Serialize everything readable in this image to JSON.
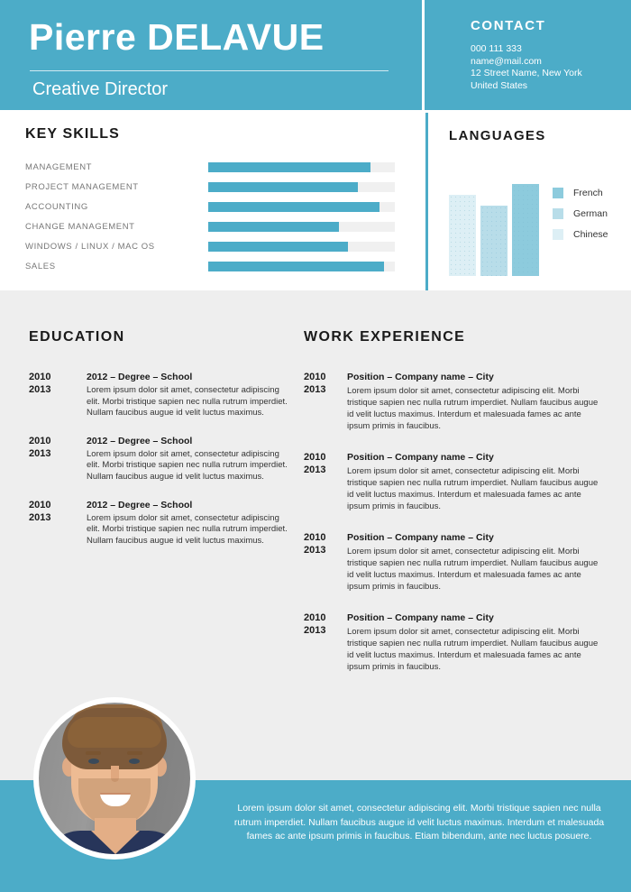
{
  "header": {
    "first_name": "Pierre",
    "last_name": "DELAVUE",
    "role": "Creative Director"
  },
  "contact": {
    "title": "CONTACT",
    "phone": "000 111 333",
    "email": "name@mail.com",
    "address": "12 Street Name, New York",
    "country": "United States"
  },
  "skills": {
    "title": "KEY SKILLS",
    "items": [
      {
        "label": "MANAGEMENT",
        "value": 87
      },
      {
        "label": "PROJECT  MANAGEMENT",
        "value": 80
      },
      {
        "label": "ACCOUNTING",
        "value": 92
      },
      {
        "label": "CHANGE  MANAGEMENT",
        "value": 70
      },
      {
        "label": "WINDOWS / LINUX  / MAC OS",
        "value": 75
      },
      {
        "label": "SALES",
        "value": 94
      }
    ]
  },
  "languages": {
    "title": "LANGUAGES",
    "legend": [
      {
        "label": "French",
        "color": "#8dcbdd"
      },
      {
        "label": "German",
        "color": "#b8dde9"
      },
      {
        "label": "Chinese",
        "color": "#ddeff5"
      }
    ]
  },
  "chart_data": {
    "type": "bar",
    "title": "LANGUAGES",
    "categories": [
      "Chinese",
      "German",
      "French"
    ],
    "values": [
      75,
      65,
      85
    ],
    "colors": [
      "#ddeff5",
      "#b8dde9",
      "#8dcbdd"
    ],
    "legend": [
      "French",
      "German",
      "Chinese"
    ],
    "legend_position": "right",
    "xlabel": "",
    "ylabel": "",
    "ylim": [
      0,
      100
    ],
    "grid": false
  },
  "education": {
    "title": "EDUCATION",
    "entries": [
      {
        "year_start": "2010",
        "year_end": "2013",
        "title": "2012 – Degree – School",
        "description": "Lorem  ipsum dolor sit amet, consectetur adipiscing elit. Morbi tristique sapien nec nulla rutrum imperdiet. Nullam faucibus augue id velit luctus maximus."
      },
      {
        "year_start": "2010",
        "year_end": "2013",
        "title": "2012 – Degree – School",
        "description": "Lorem  ipsum dolor sit amet, consectetur adipiscing elit. Morbi tristique sapien nec nulla rutrum imperdiet. Nullam faucibus augue id velit luctus maximus."
      },
      {
        "year_start": "2010",
        "year_end": "2013",
        "title": "2012 – Degree – School",
        "description": "Lorem  ipsum dolor sit amet, consectetur adipiscing elit. Morbi tristique sapien nec nulla rutrum imperdiet. Nullam faucibus augue id velit luctus maximus."
      }
    ]
  },
  "work": {
    "title": "WORK EXPERIENCE",
    "entries": [
      {
        "year_start": "2010",
        "year_end": "2013",
        "title": "Position – Company name – City",
        "description": "Lorem  ipsum dolor sit amet, consectetur  adipiscing elit. Morbi tristique sapien nec nulla rutrum imperdiet. Nullam faucibus augue id velit luctus maximus. Interdum et malesuada fames ac ante ipsum primis in faucibus."
      },
      {
        "year_start": "2010",
        "year_end": "2013",
        "title": "Position – Company name – City",
        "description": "Lorem  ipsum dolor sit amet, consectetur  adipiscing elit. Morbi tristique sapien nec nulla rutrum imperdiet. Nullam faucibus augue id velit luctus maximus. Interdum et malesuada fames ac ante ipsum primis in faucibus."
      },
      {
        "year_start": "2010",
        "year_end": "2013",
        "title": "Position – Company name – City",
        "description": "Lorem  ipsum dolor sit amet, consectetur  adipiscing elit. Morbi tristique sapien nec nulla rutrum imperdiet. Nullam faucibus augue id velit luctus maximus. Interdum et malesuada fames ac ante ipsum primis in faucibus."
      },
      {
        "year_start": "2010",
        "year_end": "2013",
        "title": "Position – Company name – City",
        "description": "Lorem  ipsum dolor sit amet, consectetur  adipiscing elit. Morbi tristique sapien nec nulla rutrum imperdiet. Nullam faucibus augue id velit luctus maximus. Interdum et malesuada fames ac ante ipsum primis in faucibus."
      }
    ]
  },
  "footer": {
    "text": "Lorem ipsum dolor sit amet, consectetur adipiscing elit. Morbi tristique sapien nec nulla rutrum imperdiet. Nullam faucibus augue id velit luctus maximus. Interdum et malesuada fames ac ante ipsum primis in faucibus. Etiam bibendum, ante nec luctus posuere."
  },
  "colors": {
    "brand": "#4cacc8",
    "page_background": "#eeeeee",
    "skill_track": "#f0f0f0"
  }
}
